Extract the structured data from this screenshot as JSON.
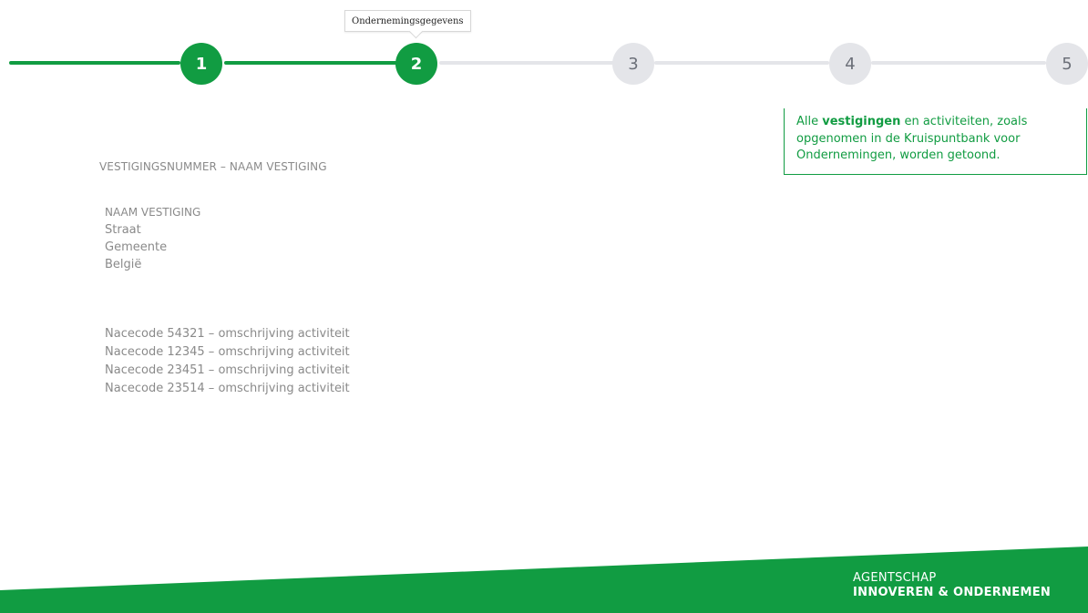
{
  "stepper": {
    "active_step_tooltip": "Ondernemingsgegevens",
    "steps": [
      {
        "label": "1",
        "state": "done"
      },
      {
        "label": "2",
        "state": "current"
      },
      {
        "label": "3",
        "state": "todo"
      },
      {
        "label": "4",
        "state": "todo"
      },
      {
        "label": "5",
        "state": "todo"
      }
    ]
  },
  "info": {
    "prefix": "Alle ",
    "bold": "vestigingen",
    "suffix": " en activiteiten, zoals opgenomen in de Kruispuntbank voor Ondernemingen, worden getoond."
  },
  "vestiging": {
    "heading": "VESTIGINGSNUMMER – NAAM VESTIGING",
    "address": {
      "name": "NAAM VESTIGING",
      "street": "Straat",
      "city": "Gemeente",
      "country": "België"
    },
    "nace_codes": [
      "Nacecode 54321 – omschrijving activiteit",
      "Nacecode 12345 – omschrijving activiteit",
      "Nacecode 23451 – omschrijving activiteit",
      "Nacecode 23514 – omschrijving activiteit"
    ]
  },
  "footer": {
    "line1": "AGENTSCHAP",
    "line2": "INNOVEREN & ONDERNEMEN"
  },
  "colors": {
    "brand_green": "#119c42",
    "inactive_grey": "#e4e5e9",
    "text_grey": "#8a8a8a"
  }
}
